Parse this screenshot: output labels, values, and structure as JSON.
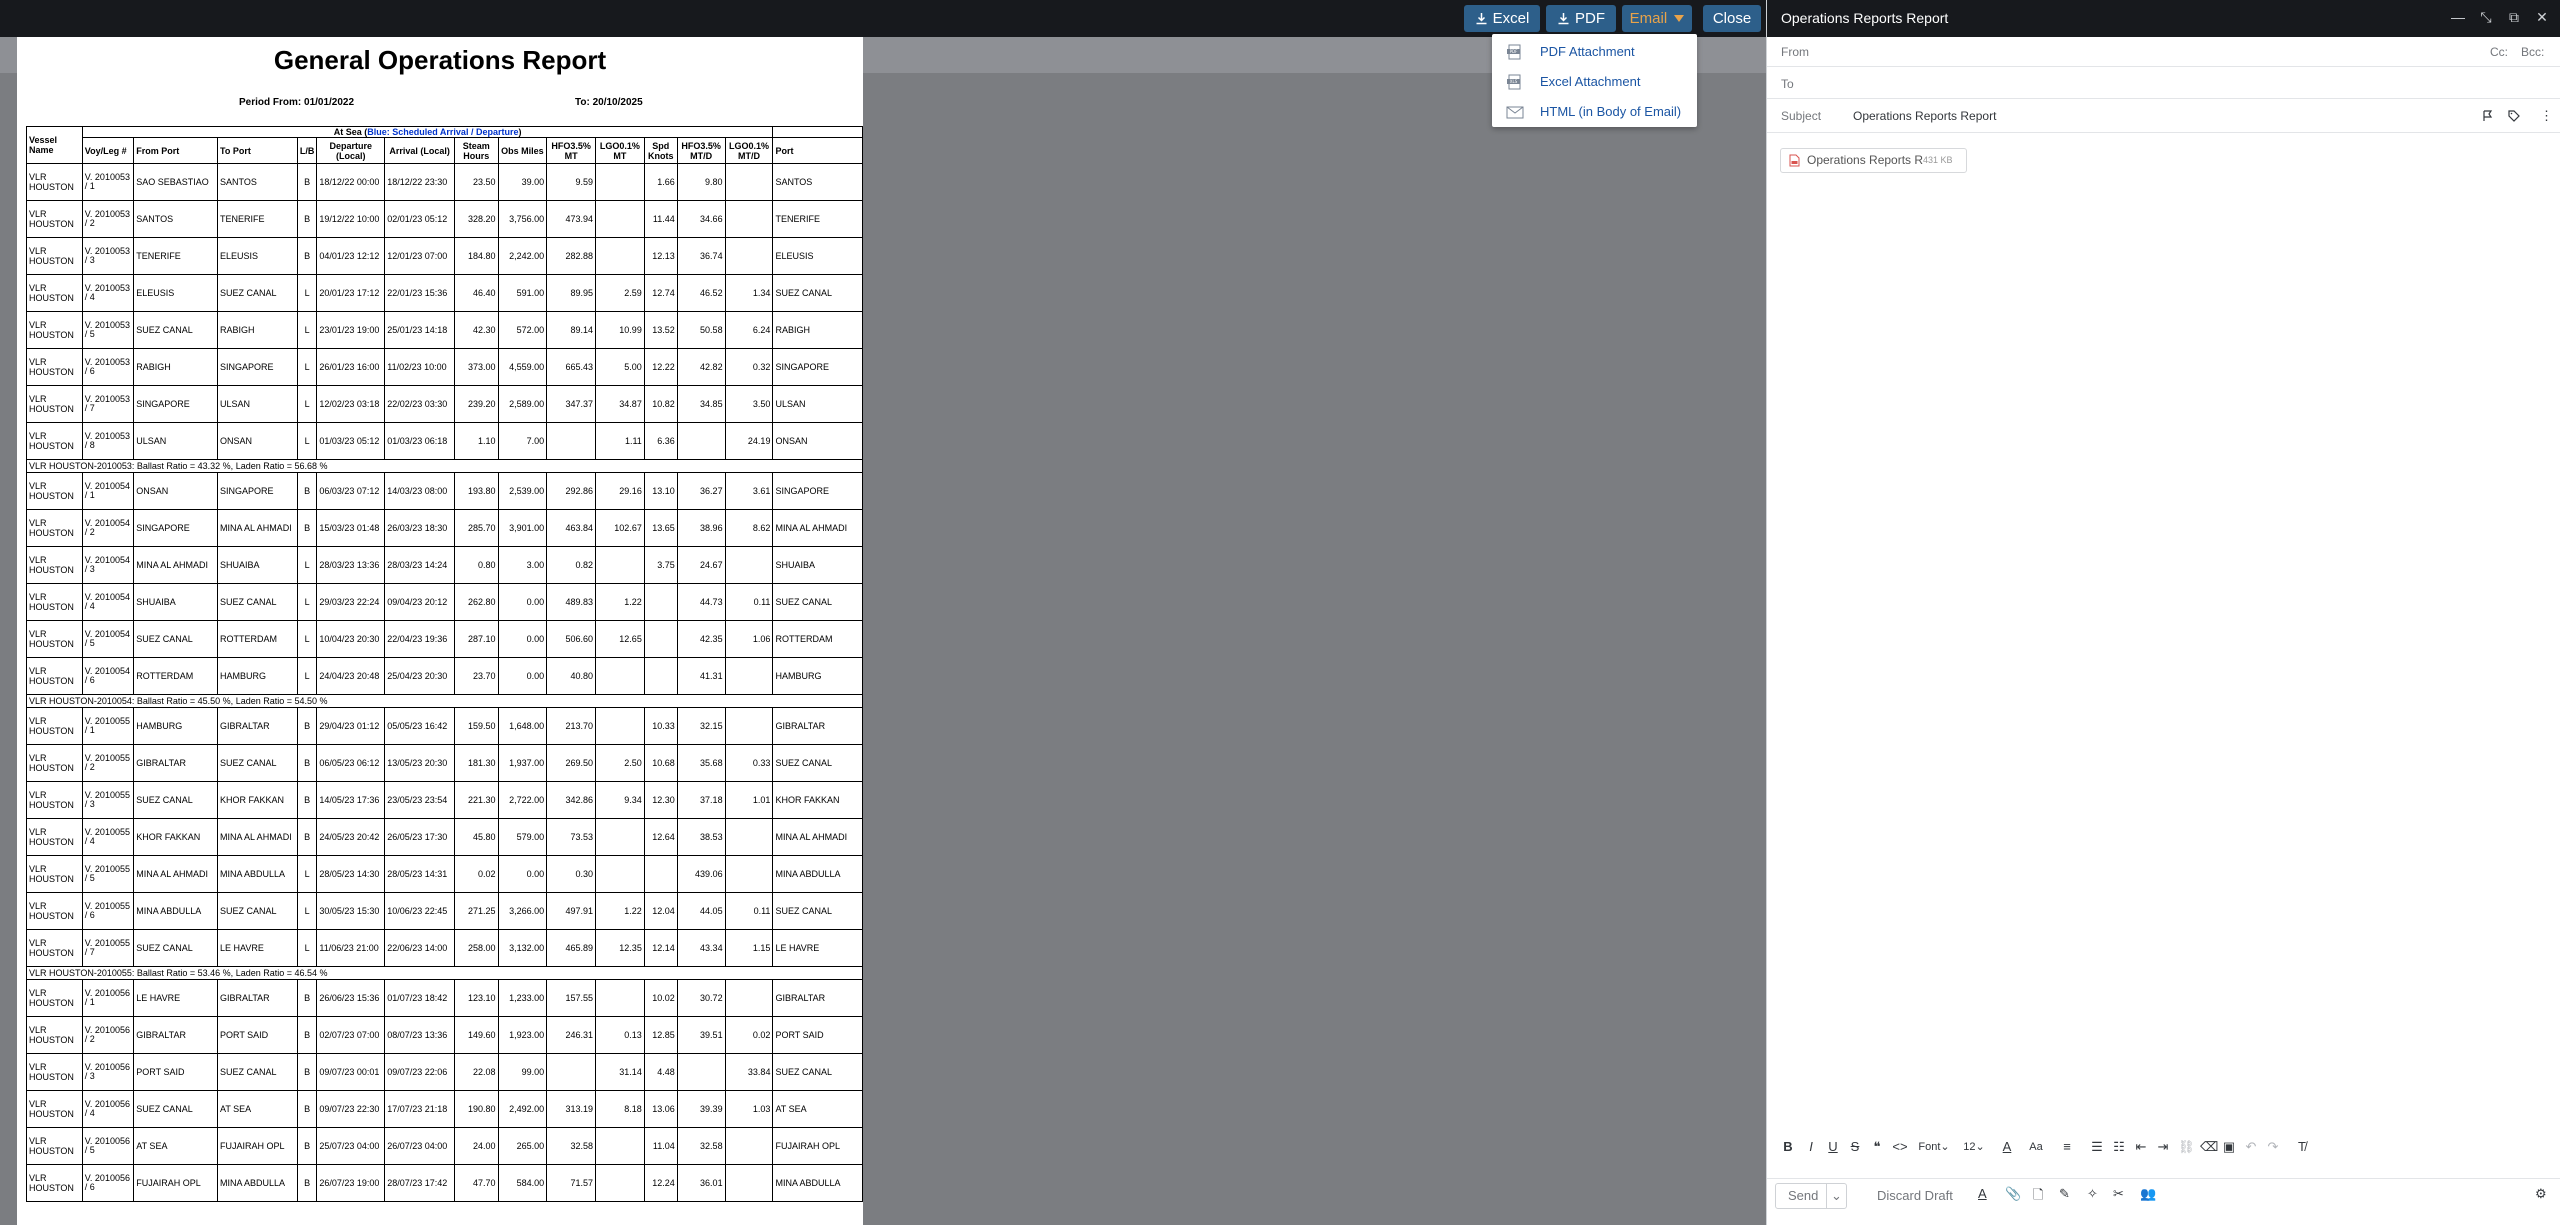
{
  "toolbar": {
    "excel_label": "Excel",
    "pdf_label": "PDF",
    "email_label": "Email",
    "close_label": "Close"
  },
  "email_menu": {
    "items": [
      {
        "label": "PDF Attachment",
        "icon": "pdf-file-icon"
      },
      {
        "label": "Excel Attachment",
        "icon": "excel-file-icon"
      },
      {
        "label": "HTML (in Body of Email)",
        "icon": "envelope-icon"
      }
    ]
  },
  "report": {
    "title": "General Operations Report",
    "period_from": "Period From: 01/01/2022",
    "period_to": "To: 20/10/2025",
    "group_header_black": "At Sea (",
    "group_header_blue": "Blue: Scheduled Arrival / Departure",
    "group_header_end": ")",
    "columns": [
      "Vessel Name",
      "Voy/Leg #",
      "From Port",
      "To Port",
      "L/B",
      "Departure (Local)",
      "Arrival (Local)",
      "Steam Hours",
      "Obs Miles",
      "HFO3.5% MT",
      "LGO0.1% MT",
      "Spd Knots",
      "HFO3.5% MT/D",
      "LGO0.1% MT/D",
      "Port"
    ],
    "rows": [
      {
        "vessel": "VLR HOUSTON",
        "voy": "V. 2010053 / 1",
        "from": "SAO SEBASTIAO",
        "to": "SANTOS",
        "lb": "B",
        "dep": "18/12/22 00:00",
        "arr": "18/12/22 23:30",
        "hours": "23.50",
        "miles": "39.00",
        "hfo": "9.59",
        "lgo": "",
        "spd": "1.66",
        "hfod": "9.80",
        "lgod": "",
        "port": "SANTOS"
      },
      {
        "vessel": "VLR HOUSTON",
        "voy": "V. 2010053 / 2",
        "from": "SANTOS",
        "to": "TENERIFE",
        "lb": "B",
        "dep": "19/12/22 10:00",
        "arr": "02/01/23 05:12",
        "hours": "328.20",
        "miles": "3,756.00",
        "hfo": "473.94",
        "lgo": "",
        "spd": "11.44",
        "hfod": "34.66",
        "lgod": "",
        "port": "TENERIFE"
      },
      {
        "vessel": "VLR HOUSTON",
        "voy": "V. 2010053 / 3",
        "from": "TENERIFE",
        "to": "ELEUSIS",
        "lb": "B",
        "dep": "04/01/23 12:12",
        "arr": "12/01/23 07:00",
        "hours": "184.80",
        "miles": "2,242.00",
        "hfo": "282.88",
        "lgo": "",
        "spd": "12.13",
        "hfod": "36.74",
        "lgod": "",
        "port": "ELEUSIS"
      },
      {
        "vessel": "VLR HOUSTON",
        "voy": "V. 2010053 / 4",
        "from": "ELEUSIS",
        "to": "SUEZ CANAL",
        "lb": "L",
        "dep": "20/01/23 17:12",
        "arr": "22/01/23 15:36",
        "hours": "46.40",
        "miles": "591.00",
        "hfo": "89.95",
        "lgo": "2.59",
        "spd": "12.74",
        "hfod": "46.52",
        "lgod": "1.34",
        "port": "SUEZ CANAL"
      },
      {
        "vessel": "VLR HOUSTON",
        "voy": "V. 2010053 / 5",
        "from": "SUEZ CANAL",
        "to": "RABIGH",
        "lb": "L",
        "dep": "23/01/23 19:00",
        "arr": "25/01/23 14:18",
        "hours": "42.30",
        "miles": "572.00",
        "hfo": "89.14",
        "lgo": "10.99",
        "spd": "13.52",
        "hfod": "50.58",
        "lgod": "6.24",
        "port": "RABIGH"
      },
      {
        "vessel": "VLR HOUSTON",
        "voy": "V. 2010053 / 6",
        "from": "RABIGH",
        "to": "SINGAPORE",
        "lb": "L",
        "dep": "26/01/23 16:00",
        "arr": "11/02/23 10:00",
        "hours": "373.00",
        "miles": "4,559.00",
        "hfo": "665.43",
        "lgo": "5.00",
        "spd": "12.22",
        "hfod": "42.82",
        "lgod": "0.32",
        "port": "SINGAPORE"
      },
      {
        "vessel": "VLR HOUSTON",
        "voy": "V. 2010053 / 7",
        "from": "SINGAPORE",
        "to": "ULSAN",
        "lb": "L",
        "dep": "12/02/23 03:18",
        "arr": "22/02/23 03:30",
        "hours": "239.20",
        "miles": "2,589.00",
        "hfo": "347.37",
        "lgo": "34.87",
        "spd": "10.82",
        "hfod": "34.85",
        "lgod": "3.50",
        "port": "ULSAN"
      },
      {
        "vessel": "VLR HOUSTON",
        "voy": "V. 2010053 / 8",
        "from": "ULSAN",
        "to": "ONSAN",
        "lb": "L",
        "dep": "01/03/23 05:12",
        "arr": "01/03/23 06:18",
        "hours": "1.10",
        "miles": "7.00",
        "hfo": "",
        "lgo": "1.11",
        "spd": "6.36",
        "hfod": "",
        "lgod": "24.19",
        "port": "ONSAN"
      },
      {
        "summary": "VLR HOUSTON-2010053: Ballast Ratio = 43.32 %, Laden Ratio = 56.68 %"
      },
      {
        "vessel": "VLR HOUSTON",
        "voy": "V. 2010054 / 1",
        "from": "ONSAN",
        "to": "SINGAPORE",
        "lb": "B",
        "dep": "06/03/23 07:12",
        "arr": "14/03/23 08:00",
        "hours": "193.80",
        "miles": "2,539.00",
        "hfo": "292.86",
        "lgo": "29.16",
        "spd": "13.10",
        "hfod": "36.27",
        "lgod": "3.61",
        "port": "SINGAPORE"
      },
      {
        "vessel": "VLR HOUSTON",
        "voy": "V. 2010054 / 2",
        "from": "SINGAPORE",
        "to": "MINA AL AHMADI",
        "lb": "B",
        "dep": "15/03/23 01:48",
        "arr": "26/03/23 18:30",
        "hours": "285.70",
        "miles": "3,901.00",
        "hfo": "463.84",
        "lgo": "102.67",
        "spd": "13.65",
        "hfod": "38.96",
        "lgod": "8.62",
        "port": "MINA AL AHMADI"
      },
      {
        "vessel": "VLR HOUSTON",
        "voy": "V. 2010054 / 3",
        "from": "MINA AL AHMADI",
        "to": "SHUAIBA",
        "lb": "L",
        "dep": "28/03/23 13:36",
        "arr": "28/03/23 14:24",
        "hours": "0.80",
        "miles": "3.00",
        "hfo": "0.82",
        "lgo": "",
        "spd": "3.75",
        "hfod": "24.67",
        "lgod": "",
        "port": "SHUAIBA"
      },
      {
        "vessel": "VLR HOUSTON",
        "voy": "V. 2010054 / 4",
        "from": "SHUAIBA",
        "to": "SUEZ CANAL",
        "lb": "L",
        "dep": "29/03/23 22:24",
        "arr": "09/04/23 20:12",
        "hours": "262.80",
        "miles": "0.00",
        "hfo": "489.83",
        "lgo": "1.22",
        "spd": "",
        "hfod": "44.73",
        "lgod": "0.11",
        "port": "SUEZ CANAL"
      },
      {
        "vessel": "VLR HOUSTON",
        "voy": "V. 2010054 / 5",
        "from": "SUEZ CANAL",
        "to": "ROTTERDAM",
        "lb": "L",
        "dep": "10/04/23 20:30",
        "arr": "22/04/23 19:36",
        "hours": "287.10",
        "miles": "0.00",
        "hfo": "506.60",
        "lgo": "12.65",
        "spd": "",
        "hfod": "42.35",
        "lgod": "1.06",
        "port": "ROTTERDAM"
      },
      {
        "vessel": "VLR HOUSTON",
        "voy": "V. 2010054 / 6",
        "from": "ROTTERDAM",
        "to": "HAMBURG",
        "lb": "L",
        "dep": "24/04/23 20:48",
        "arr": "25/04/23 20:30",
        "hours": "23.70",
        "miles": "0.00",
        "hfo": "40.80",
        "lgo": "",
        "spd": "",
        "hfod": "41.31",
        "lgod": "",
        "port": "HAMBURG"
      },
      {
        "summary": "VLR HOUSTON-2010054: Ballast Ratio = 45.50 %, Laden Ratio = 54.50 %"
      },
      {
        "vessel": "VLR HOUSTON",
        "voy": "V. 2010055 / 1",
        "from": "HAMBURG",
        "to": "GIBRALTAR",
        "lb": "B",
        "dep": "29/04/23 01:12",
        "arr": "05/05/23 16:42",
        "hours": "159.50",
        "miles": "1,648.00",
        "hfo": "213.70",
        "lgo": "",
        "spd": "10.33",
        "hfod": "32.15",
        "lgod": "",
        "port": "GIBRALTAR"
      },
      {
        "vessel": "VLR HOUSTON",
        "voy": "V. 2010055 / 2",
        "from": "GIBRALTAR",
        "to": "SUEZ CANAL",
        "lb": "B",
        "dep": "06/05/23 06:12",
        "arr": "13/05/23 20:30",
        "hours": "181.30",
        "miles": "1,937.00",
        "hfo": "269.50",
        "lgo": "2.50",
        "spd": "10.68",
        "hfod": "35.68",
        "lgod": "0.33",
        "port": "SUEZ CANAL"
      },
      {
        "vessel": "VLR HOUSTON",
        "voy": "V. 2010055 / 3",
        "from": "SUEZ CANAL",
        "to": "KHOR FAKKAN",
        "lb": "B",
        "dep": "14/05/23 17:36",
        "arr": "23/05/23 23:54",
        "hours": "221.30",
        "miles": "2,722.00",
        "hfo": "342.86",
        "lgo": "9.34",
        "spd": "12.30",
        "hfod": "37.18",
        "lgod": "1.01",
        "port": "KHOR FAKKAN"
      },
      {
        "vessel": "VLR HOUSTON",
        "voy": "V. 2010055 / 4",
        "from": "KHOR FAKKAN",
        "to": "MINA AL AHMADI",
        "lb": "B",
        "dep": "24/05/23 20:42",
        "arr": "26/05/23 17:30",
        "hours": "45.80",
        "miles": "579.00",
        "hfo": "73.53",
        "lgo": "",
        "spd": "12.64",
        "hfod": "38.53",
        "lgod": "",
        "port": "MINA AL AHMADI"
      },
      {
        "vessel": "VLR HOUSTON",
        "voy": "V. 2010055 / 5",
        "from": "MINA AL AHMADI",
        "to": "MINA ABDULLA",
        "lb": "L",
        "dep": "28/05/23 14:30",
        "arr": "28/05/23 14:31",
        "hours": "0.02",
        "miles": "0.00",
        "hfo": "0.30",
        "lgo": "",
        "spd": "",
        "hfod": "439.06",
        "lgod": "",
        "port": "MINA ABDULLA"
      },
      {
        "vessel": "VLR HOUSTON",
        "voy": "V. 2010055 / 6",
        "from": "MINA ABDULLA",
        "to": "SUEZ CANAL",
        "lb": "L",
        "dep": "30/05/23 15:30",
        "arr": "10/06/23 22:45",
        "hours": "271.25",
        "miles": "3,266.00",
        "hfo": "497.91",
        "lgo": "1.22",
        "spd": "12.04",
        "hfod": "44.05",
        "lgod": "0.11",
        "port": "SUEZ CANAL"
      },
      {
        "vessel": "VLR HOUSTON",
        "voy": "V. 2010055 / 7",
        "from": "SUEZ CANAL",
        "to": "LE HAVRE",
        "lb": "L",
        "dep": "11/06/23 21:00",
        "arr": "22/06/23 14:00",
        "hours": "258.00",
        "miles": "3,132.00",
        "hfo": "465.89",
        "lgo": "12.35",
        "spd": "12.14",
        "hfod": "43.34",
        "lgod": "1.15",
        "port": "LE HAVRE"
      },
      {
        "summary": "VLR HOUSTON-2010055: Ballast Ratio = 53.46 %, Laden Ratio = 46.54 %"
      },
      {
        "vessel": "VLR HOUSTON",
        "voy": "V. 2010056 / 1",
        "from": "LE HAVRE",
        "to": "GIBRALTAR",
        "lb": "B",
        "dep": "26/06/23 15:36",
        "arr": "01/07/23 18:42",
        "hours": "123.10",
        "miles": "1,233.00",
        "hfo": "157.55",
        "lgo": "",
        "spd": "10.02",
        "hfod": "30.72",
        "lgod": "",
        "port": "GIBRALTAR"
      },
      {
        "vessel": "VLR HOUSTON",
        "voy": "V. 2010056 / 2",
        "from": "GIBRALTAR",
        "to": "PORT SAID",
        "lb": "B",
        "dep": "02/07/23 07:00",
        "arr": "08/07/23 13:36",
        "hours": "149.60",
        "miles": "1,923.00",
        "hfo": "246.31",
        "lgo": "0.13",
        "spd": "12.85",
        "hfod": "39.51",
        "lgod": "0.02",
        "port": "PORT SAID"
      },
      {
        "vessel": "VLR HOUSTON",
        "voy": "V. 2010056 / 3",
        "from": "PORT SAID",
        "to": "SUEZ CANAL",
        "lb": "B",
        "dep": "09/07/23 00:01",
        "arr": "09/07/23 22:06",
        "hours": "22.08",
        "miles": "99.00",
        "hfo": "",
        "lgo": "31.14",
        "spd": "4.48",
        "hfod": "",
        "lgod": "33.84",
        "port": "SUEZ CANAL"
      },
      {
        "vessel": "VLR HOUSTON",
        "voy": "V. 2010056 / 4",
        "from": "SUEZ CANAL",
        "to": "AT SEA",
        "lb": "B",
        "dep": "09/07/23 22:30",
        "arr": "17/07/23 21:18",
        "hours": "190.80",
        "miles": "2,492.00",
        "hfo": "313.19",
        "lgo": "8.18",
        "spd": "13.06",
        "hfod": "39.39",
        "lgod": "1.03",
        "port": "AT SEA"
      },
      {
        "vessel": "VLR HOUSTON",
        "voy": "V. 2010056 / 5",
        "from": "AT SEA",
        "to": "FUJAIRAH OPL",
        "lb": "B",
        "dep": "25/07/23 04:00",
        "arr": "26/07/23 04:00",
        "hours": "24.00",
        "miles": "265.00",
        "hfo": "32.58",
        "lgo": "",
        "spd": "11.04",
        "hfod": "32.58",
        "lgod": "",
        "port": "FUJAIRAH OPL"
      },
      {
        "vessel": "VLR HOUSTON",
        "voy": "V. 2010056 / 6",
        "from": "FUJAIRAH OPL",
        "to": "MINA ABDULLA",
        "lb": "B",
        "dep": "26/07/23 19:00",
        "arr": "28/07/23 17:42",
        "hours": "47.70",
        "miles": "584.00",
        "hfo": "71.57",
        "lgo": "",
        "spd": "12.24",
        "hfod": "36.01",
        "lgod": "",
        "port": "MINA ABDULLA"
      }
    ]
  },
  "email": {
    "window_title": "Operations Reports Report",
    "from_label": "From",
    "to_label": "To",
    "cc_label": "Cc:",
    "bcc_label": "Bcc:",
    "subject_label": "Subject",
    "subject_value": "Operations Reports Report",
    "attachment_name": "Operations Reports R",
    "attachment_size": "431 KB",
    "font_label": "Font",
    "font_size": "12",
    "send_label": "Send",
    "discard_label": "Discard Draft"
  }
}
